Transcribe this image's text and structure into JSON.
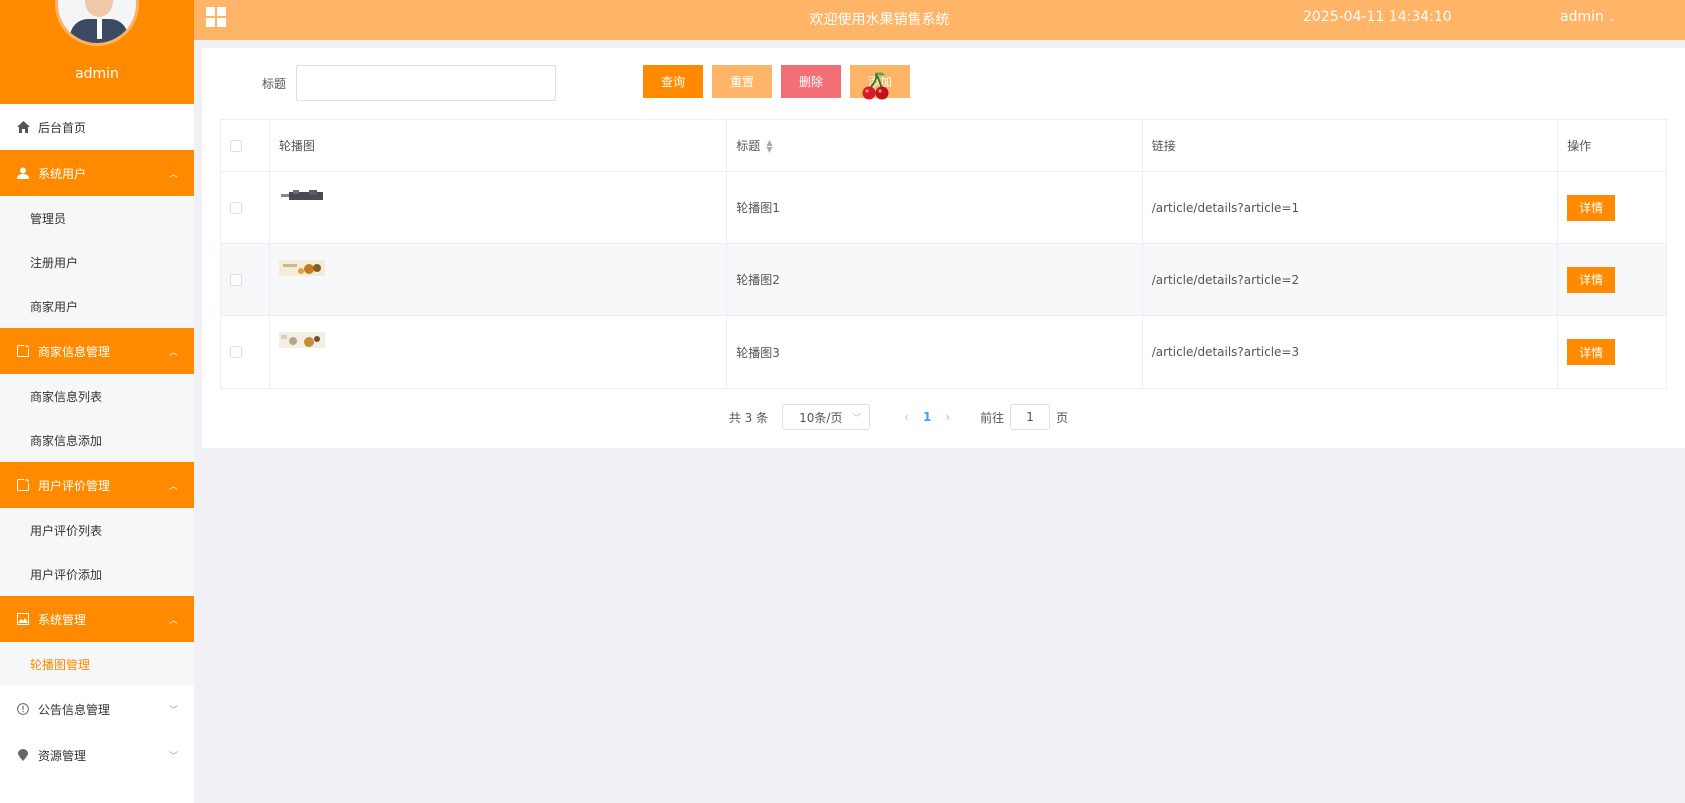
{
  "sidebar": {
    "user_name": "admin",
    "menu": [
      {
        "label": "后台首页",
        "icon": "home-icon"
      },
      {
        "label": "系统用户",
        "icon": "user-icon",
        "children": [
          "管理员",
          "注册用户",
          "商家用户"
        ]
      },
      {
        "label": "商家信息管理",
        "icon": "document-icon",
        "children": [
          "商家信息列表",
          "商家信息添加"
        ]
      },
      {
        "label": "用户评价管理",
        "icon": "document-icon",
        "children": [
          "用户评价列表",
          "用户评价添加"
        ]
      },
      {
        "label": "系统管理",
        "icon": "image-icon",
        "children": [
          "轮播图管理"
        ]
      },
      {
        "label": "公告信息管理",
        "icon": "info-icon"
      },
      {
        "label": "资源管理",
        "icon": "location-icon"
      }
    ]
  },
  "header": {
    "title": "欢迎使用水果销售系统",
    "datetime": "2025-04-11 14:34:10",
    "user": "admin"
  },
  "search": {
    "label": "标题",
    "value": "",
    "buttons": {
      "query": "查询",
      "reset": "重置",
      "delete": "删除",
      "add": "添加"
    }
  },
  "table": {
    "headers": {
      "image": "轮播图",
      "title": "标题",
      "link": "链接",
      "action": "操作"
    },
    "rows": [
      {
        "title": "轮播图1",
        "link": "/article/details?article=1",
        "action": "详情"
      },
      {
        "title": "轮播图2",
        "link": "/article/details?article=2",
        "action": "详情"
      },
      {
        "title": "轮播图3",
        "link": "/article/details?article=3",
        "action": "详情"
      }
    ]
  },
  "pagination": {
    "total": "共 3 条",
    "page_size": "10条/页",
    "current_page": "1",
    "goto_prefix": "前往",
    "goto_value": "1",
    "goto_suffix": "页"
  },
  "colors": {
    "primary": "#ff8a00",
    "header": "#ffb468",
    "danger": "#f27075"
  }
}
